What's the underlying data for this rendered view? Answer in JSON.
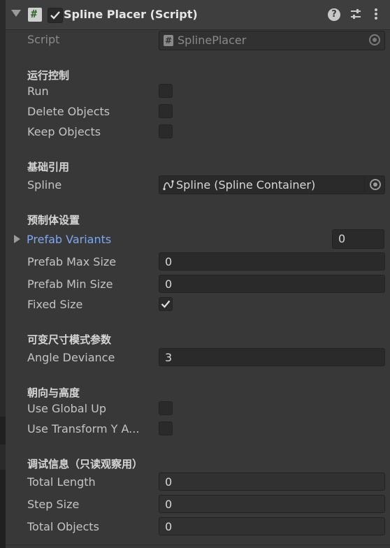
{
  "component": {
    "title": "Spline Placer (Script)",
    "enabled": true
  },
  "script": {
    "label": "Script",
    "value": "SplinePlacer"
  },
  "sections": {
    "run_control": "运行控制",
    "base_refs": "基础引用",
    "prefab_settings": "预制体设置",
    "variable_size": "可变尺寸模式参数",
    "orientation": "朝向与高度",
    "debug": "调试信息（只读观察用）"
  },
  "run": {
    "label": "Run",
    "checked": false
  },
  "delete_objects": {
    "label": "Delete Objects",
    "checked": false
  },
  "keep_objects": {
    "label": "Keep Objects",
    "checked": false
  },
  "spline": {
    "label": "Spline",
    "value": "Spline (Spline Container)"
  },
  "prefab_variants": {
    "label": "Prefab Variants",
    "count": "0"
  },
  "prefab_max_size": {
    "label": "Prefab Max Size",
    "value": "0"
  },
  "prefab_min_size": {
    "label": "Prefab Min Size",
    "value": "0"
  },
  "fixed_size": {
    "label": "Fixed Size",
    "checked": true
  },
  "angle_deviance": {
    "label": "Angle Deviance",
    "value": "3"
  },
  "use_global_up": {
    "label": "Use Global Up",
    "checked": false
  },
  "use_transform_y": {
    "label": "Use Transform Y A...",
    "checked": false
  },
  "total_length": {
    "label": "Total Length",
    "value": "0"
  },
  "step_size": {
    "label": "Step Size",
    "value": "0"
  },
  "total_objects": {
    "label": "Total Objects",
    "value": "0"
  },
  "icons": {
    "fold": "triangle-down-icon",
    "script": "script-hash-icon",
    "help": "question-icon",
    "presets": "sliders-icon",
    "menu": "kebab-menu-icon",
    "spline": "spline-curve-icon",
    "picker": "object-picker-icon"
  }
}
